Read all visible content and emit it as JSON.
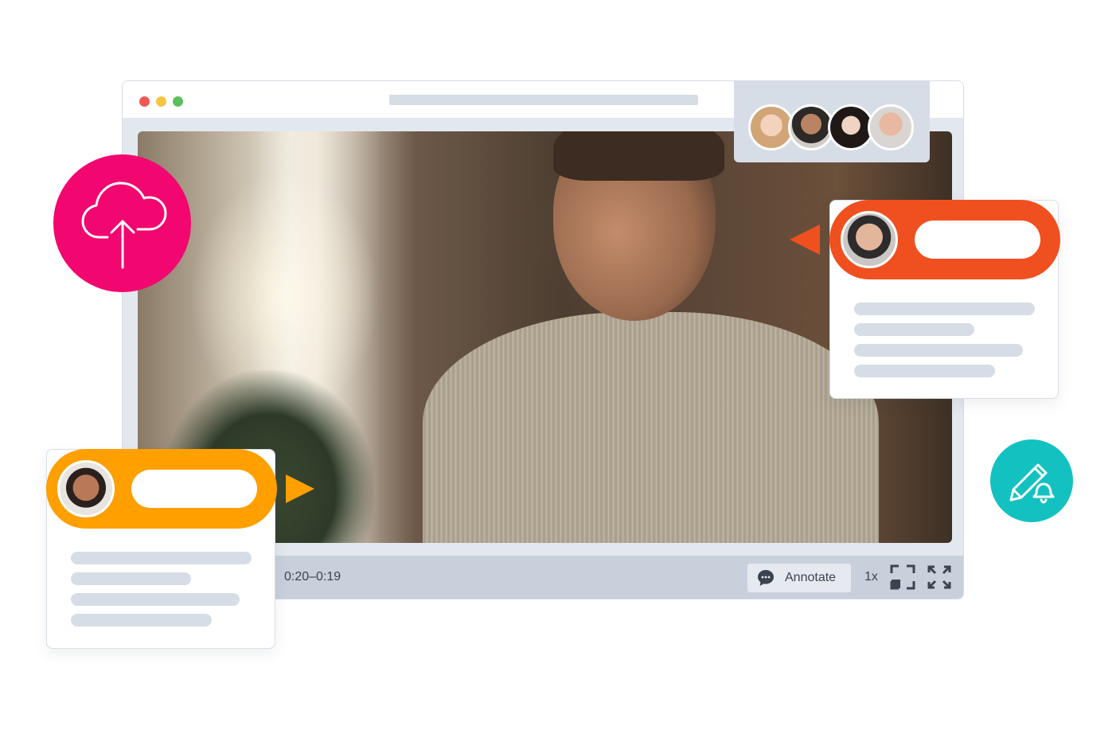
{
  "player": {
    "timecode": "0:20–0:19",
    "annotate_label": "Annotate",
    "speed": "1x"
  },
  "icons": {
    "upload": "cloud-upload-icon",
    "annotate": "comment-bubble-icon",
    "focus": "focus-frame-icon",
    "expand": "fullscreen-expand-icon",
    "edit_notify": "pencil-bell-icon"
  },
  "viewers": [
    {
      "name": "viewer-1"
    },
    {
      "name": "viewer-2"
    },
    {
      "name": "viewer-3"
    },
    {
      "name": "viewer-4"
    }
  ],
  "colors": {
    "upload_pink": "#f2066f",
    "comment_orange_red": "#f0501f",
    "comment_orange": "#ff9f00",
    "teal": "#14c1c1",
    "panel_gray": "#d6dde6"
  }
}
